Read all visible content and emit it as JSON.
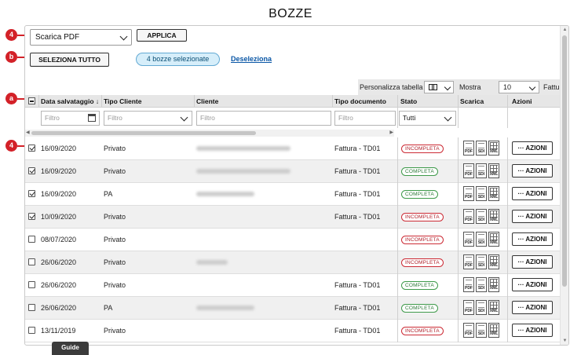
{
  "page": {
    "title": "BOZZE"
  },
  "top_controls": {
    "action_select": {
      "value": "Scarica PDF"
    },
    "apply_label": "APPLICA",
    "select_all_label": "SELEZIONA TUTTO",
    "selected_count_label": "4 bozze selezionate",
    "deselect_label": "Deseleziona"
  },
  "callouts": {
    "c4_top": "4",
    "c5": "5",
    "cb": "b",
    "ca": "a",
    "c4_rows": "4"
  },
  "toolbar": {
    "customize_label": "Personalizza tabella",
    "show_label": "Mostra",
    "page_size": "10",
    "fatture_label": "Fatture"
  },
  "table": {
    "headers": {
      "data": "Data salvataggio ↓",
      "tipo_cliente": "Tipo Cliente",
      "cliente": "Cliente",
      "tipo_documento": "Tipo documento",
      "stato": "Stato",
      "scarica": "Scarica",
      "azioni": "Azioni"
    },
    "filters": {
      "data_placeholder": "Filtro",
      "tipo_cliente_placeholder": "Filtro",
      "cliente_placeholder": "Filtro",
      "tipo_documento_placeholder": "Filtro",
      "stato_value": "Tutti"
    },
    "download_labels": {
      "pdf": "PDF",
      "sdi": "SDI",
      "xml": "XML"
    },
    "action_button_label": "··· AZIONI",
    "rows": [
      {
        "checked": true,
        "date": "16/09/2020",
        "client_type": "Privato",
        "doc_type": "Fattura - TD01",
        "status": "INCOMPLETA",
        "blur_w": 120
      },
      {
        "checked": true,
        "date": "16/09/2020",
        "client_type": "Privato",
        "doc_type": "Fattura - TD01",
        "status": "COMPLETA",
        "blur_w": 120
      },
      {
        "checked": true,
        "date": "16/09/2020",
        "client_type": "PA",
        "doc_type": "Fattura - TD01",
        "status": "COMPLETA",
        "blur_w": 74
      },
      {
        "checked": true,
        "date": "10/09/2020",
        "client_type": "Privato",
        "doc_type": "Fattura - TD01",
        "status": "INCOMPLETA",
        "blur_w": 0
      },
      {
        "checked": false,
        "date": "08/07/2020",
        "client_type": "Privato",
        "doc_type": "",
        "status": "INCOMPLETA",
        "blur_w": 0
      },
      {
        "checked": false,
        "date": "26/06/2020",
        "client_type": "Privato",
        "doc_type": "",
        "status": "INCOMPLETA",
        "blur_w": 40
      },
      {
        "checked": false,
        "date": "26/06/2020",
        "client_type": "Privato",
        "doc_type": "Fattura - TD01",
        "status": "COMPLETA",
        "blur_w": 0
      },
      {
        "checked": false,
        "date": "26/06/2020",
        "client_type": "PA",
        "doc_type": "Fattura - TD01",
        "status": "COMPLETA",
        "blur_w": 74
      },
      {
        "checked": false,
        "date": "13/11/2019",
        "client_type": "Privato",
        "doc_type": "Fattura - TD01",
        "status": "INCOMPLETA",
        "blur_w": 0
      }
    ]
  },
  "guide_tab": "Guide",
  "colors": {
    "accent_red": "#d32128",
    "pill_bg": "#d6eefa",
    "complete": "#3e9a4a",
    "incomplete": "#cc2b35"
  }
}
